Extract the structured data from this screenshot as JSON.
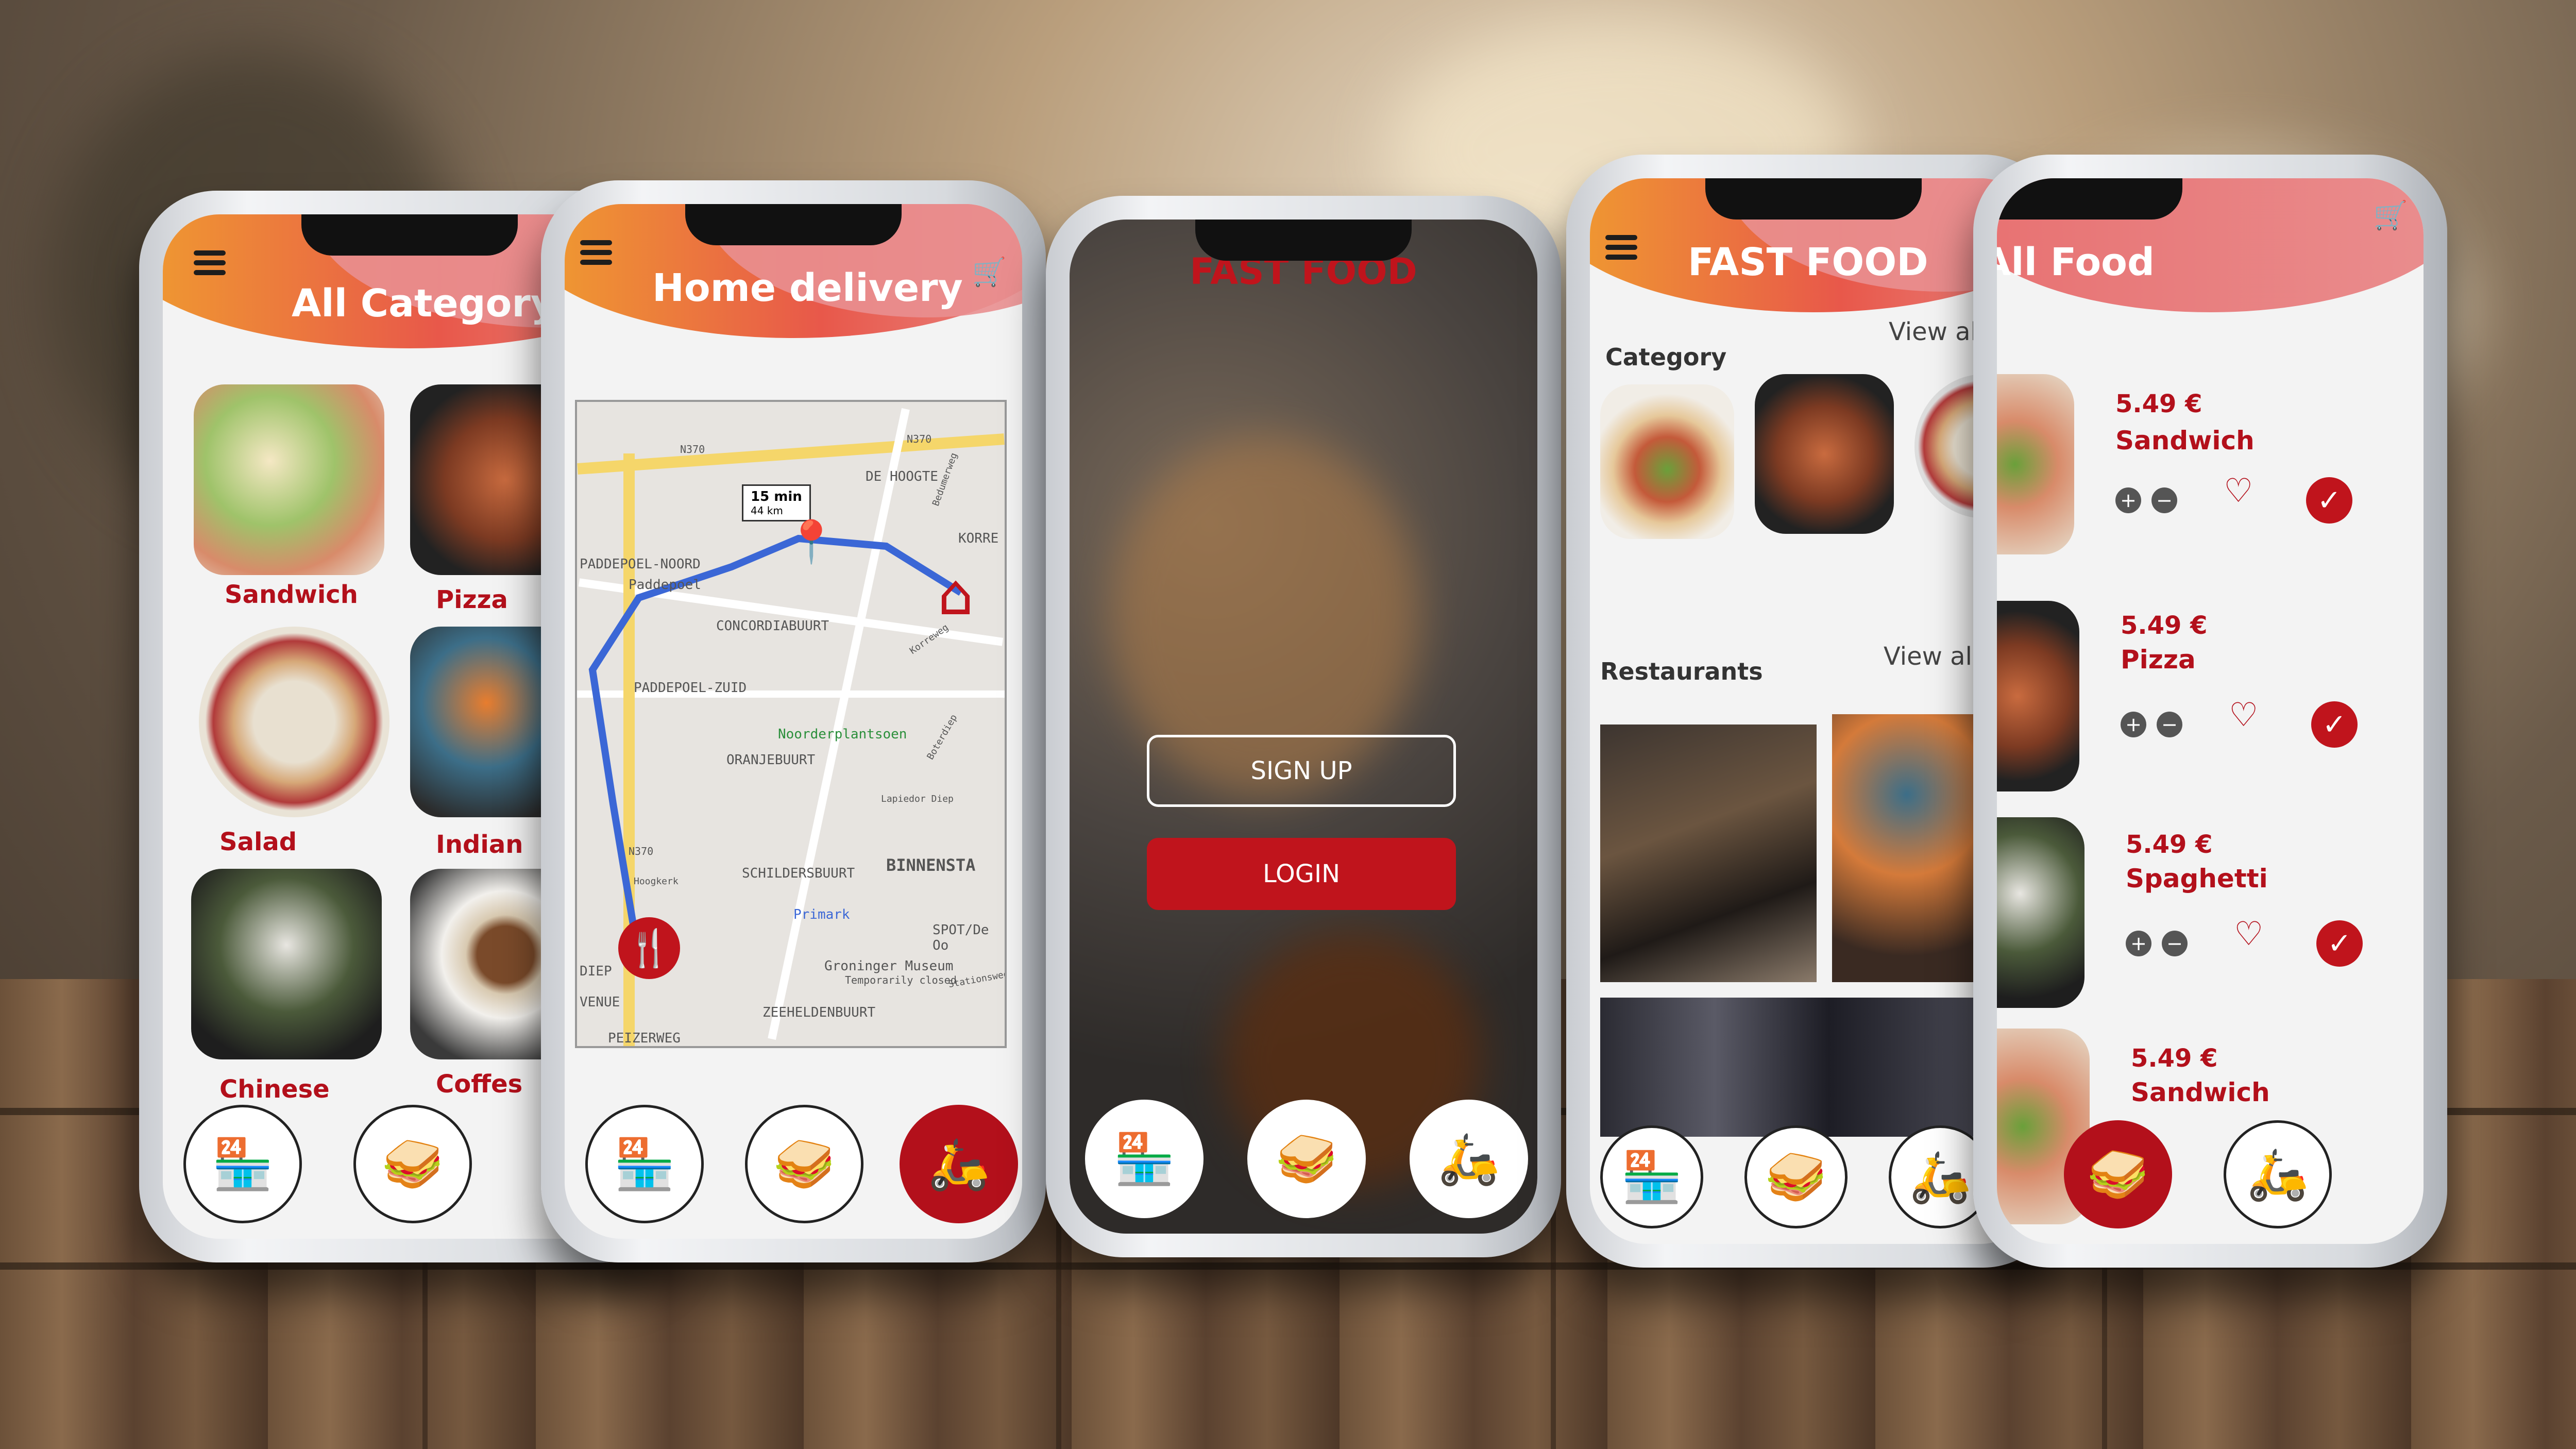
{
  "screens": {
    "category": {
      "title": "All Category",
      "items": [
        "Sandwich",
        "Pizza",
        "Salad",
        "Indian",
        "Chinese",
        "Coffes"
      ]
    },
    "delivery": {
      "title": "Home delivery",
      "route_time": "15 min",
      "route_dist": "44 km",
      "map_labels": [
        "DE HOOGTE",
        "KORRE",
        "PADDEPOEL-NOORD",
        "Paddepoel",
        "CONCORDIABUURT",
        "PADDEPOEL-ZUID",
        "Noorderplantsoen",
        "ORANJEBUURT",
        "SCHILDERSBUURT",
        "BINNENSTA",
        "Primark",
        "SPOT/De Oo",
        "Groninger Museum",
        "Temporarily closed",
        "ZEEHELDENBUURT",
        "N370",
        "N370",
        "N370",
        "Hoogkerk",
        "VENUE",
        "DIEP",
        "PEIZERWEG",
        "Lapiedor Diep",
        "Stationsweg",
        "Bedumerweg",
        "Korreweg",
        "Boterdiep"
      ]
    },
    "login": {
      "brand": "FAST FOOD",
      "signup": "SIGN UP",
      "login": "LOGIN"
    },
    "fastfood": {
      "title": "FAST FOOD",
      "category": "Category",
      "view_all_1": "View all",
      "restaurants": "Restaurants",
      "view_all_2": "View all"
    },
    "allfood": {
      "title": "All Food",
      "items": [
        {
          "price": "5.49  €",
          "name": "Sandwich"
        },
        {
          "price": "5.49  €",
          "name": "Pizza"
        },
        {
          "price": "5.49  €",
          "name": "Spaghetti"
        },
        {
          "price": "5.49  €",
          "name": "Sandwich"
        }
      ]
    }
  },
  "icons": {
    "store": "store-icon",
    "sandwich": "sandwich-icon",
    "scooter": "delivery-scooter-icon",
    "cart": "cart-icon",
    "menu": "hamburger-menu-icon"
  },
  "colors": {
    "accent": "#b3101b",
    "header_orange": "#f0a02e",
    "header_pink": "#e98f90"
  }
}
